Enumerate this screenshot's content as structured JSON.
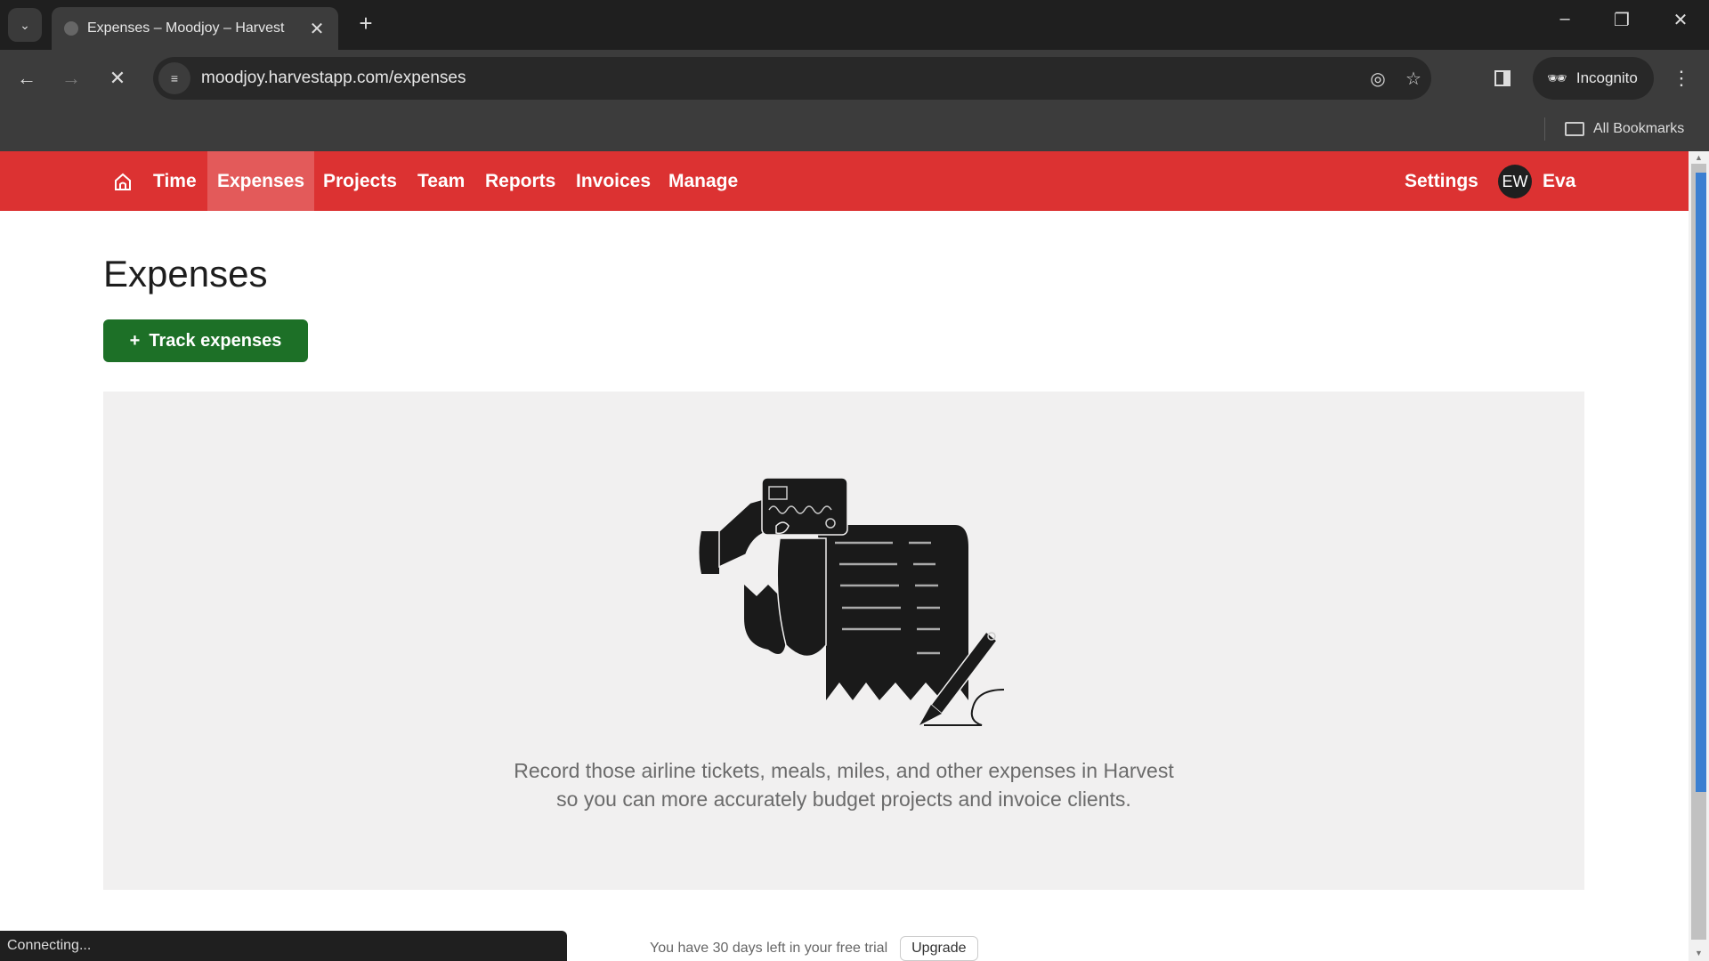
{
  "browser": {
    "tab_title": "Expenses – Moodjoy – Harvest",
    "url": "moodjoy.harvestapp.com/expenses",
    "incognito_label": "Incognito",
    "bookmarks_label": "All Bookmarks",
    "status_text": "Connecting..."
  },
  "nav": {
    "items": [
      {
        "label": "Time"
      },
      {
        "label": "Expenses",
        "active": true
      },
      {
        "label": "Projects"
      },
      {
        "label": "Team"
      },
      {
        "label": "Reports"
      },
      {
        "label": "Invoices"
      },
      {
        "label": "Manage"
      }
    ],
    "settings_label": "Settings",
    "user_initials": "EW",
    "user_name": "Eva"
  },
  "page": {
    "title": "Expenses",
    "track_button_label": "Track expenses",
    "empty_line1": "Record those airline tickets, meals, miles, and other expenses in Harvest",
    "empty_line2": "so you can more accurately budget projects and invoice clients.",
    "trial_text": "You have 30 days left in your free trial",
    "upgrade_label": "Upgrade"
  },
  "colors": {
    "brand_red": "#dc3232",
    "active_nav": "#e35a5a",
    "primary_green": "#1d7027"
  }
}
